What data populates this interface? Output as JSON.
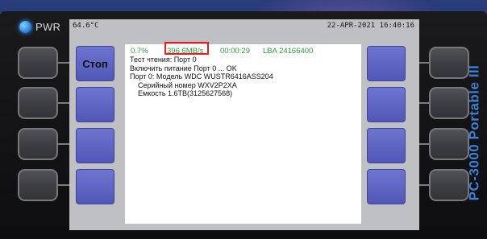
{
  "indicator": {
    "label": "PWR"
  },
  "screen": {
    "temperature": "64.6°C",
    "datetime": "22-APR-2021 16:40:16",
    "soft_buttons": {
      "stop_label": "Стоп"
    },
    "status": {
      "progress": "0.7%",
      "speed": "396.6MB/s",
      "elapsed": "00:00:29",
      "lba": "LBA 24166400"
    },
    "log_lines": [
      "Тест чтения: Порт 0",
      "Включить питание Порт 0 ... OK",
      "Порт 0: Модель WDC WUSTR6416ASS204",
      "Серийный номер WXV2P2XA",
      "Емкость 1.6TB(3125627568)"
    ]
  },
  "brand": {
    "name": "PC-3000 Portable III"
  },
  "colors": {
    "status_text": "#2f9a3c",
    "highlight_border": "#e0201e",
    "soft_button": "#5a60c0",
    "brand": "#3d7fd6",
    "led": "#2f8fe6"
  }
}
